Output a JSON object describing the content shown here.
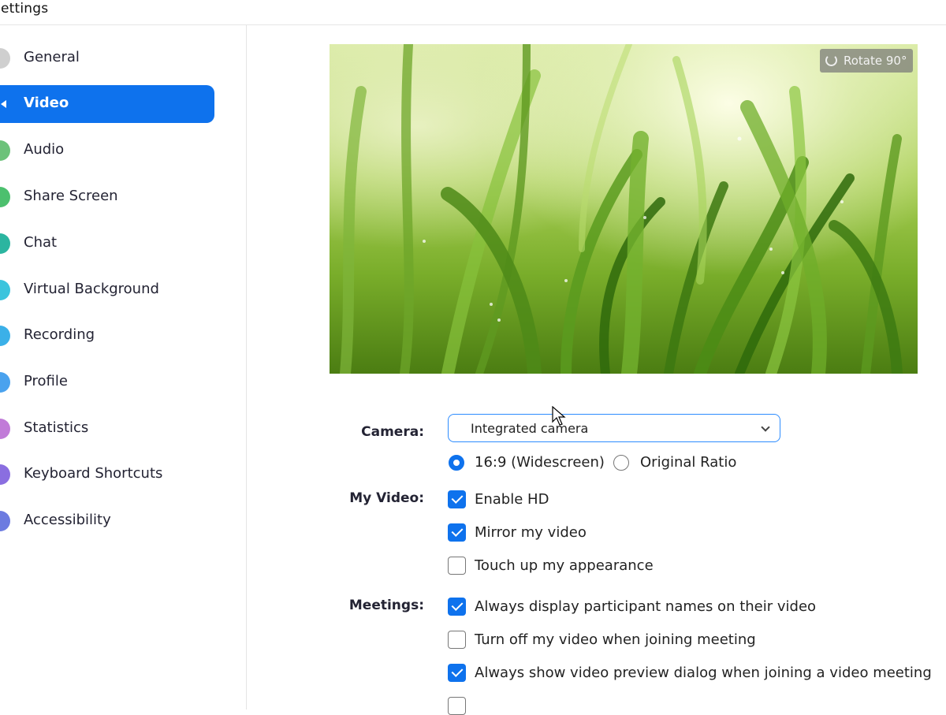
{
  "window": {
    "title": "Settings"
  },
  "sidebar": {
    "items": [
      {
        "label": "General",
        "icon": "gear-icon",
        "color": "#c8c8c8"
      },
      {
        "label": "Video",
        "icon": "video-icon",
        "color": "#0e72ed",
        "active": true
      },
      {
        "label": "Audio",
        "icon": "headphones-icon",
        "color": "#6cc27a"
      },
      {
        "label": "Share Screen",
        "icon": "share-screen-icon",
        "color": "#4cc06e"
      },
      {
        "label": "Chat",
        "icon": "chat-icon",
        "color": "#2bb5a0"
      },
      {
        "label": "Virtual Background",
        "icon": "virtual-background-icon",
        "color": "#3bc4dd"
      },
      {
        "label": "Recording",
        "icon": "recording-icon",
        "color": "#3bb0e8"
      },
      {
        "label": "Profile",
        "icon": "profile-icon",
        "color": "#4aa2ee"
      },
      {
        "label": "Statistics",
        "icon": "statistics-icon",
        "color": "#c17bd8"
      },
      {
        "label": "Keyboard Shortcuts",
        "icon": "keyboard-icon",
        "color": "#8a6ee0"
      },
      {
        "label": "Accessibility",
        "icon": "accessibility-icon",
        "color": "#6c7be0"
      }
    ]
  },
  "preview": {
    "rotate_label": "Rotate 90°"
  },
  "camera": {
    "label": "Camera:",
    "selected": "Integrated camera",
    "ratio_options": [
      {
        "label": "16:9 (Widescreen)",
        "selected": true
      },
      {
        "label": "Original Ratio",
        "selected": false
      }
    ]
  },
  "my_video": {
    "label": "My Video:",
    "options": [
      {
        "label": "Enable HD",
        "checked": true
      },
      {
        "label": "Mirror my video",
        "checked": true
      },
      {
        "label": "Touch up my appearance",
        "checked": false
      }
    ]
  },
  "meetings": {
    "label": "Meetings:",
    "options": [
      {
        "label": "Always display participant names on their video",
        "checked": true
      },
      {
        "label": "Turn off my video when joining meeting",
        "checked": false
      },
      {
        "label": "Always show video preview dialog when joining a video meeting",
        "checked": true
      }
    ]
  },
  "colors": {
    "accent": "#0e72ed",
    "focus_border": "#2d8cff"
  }
}
